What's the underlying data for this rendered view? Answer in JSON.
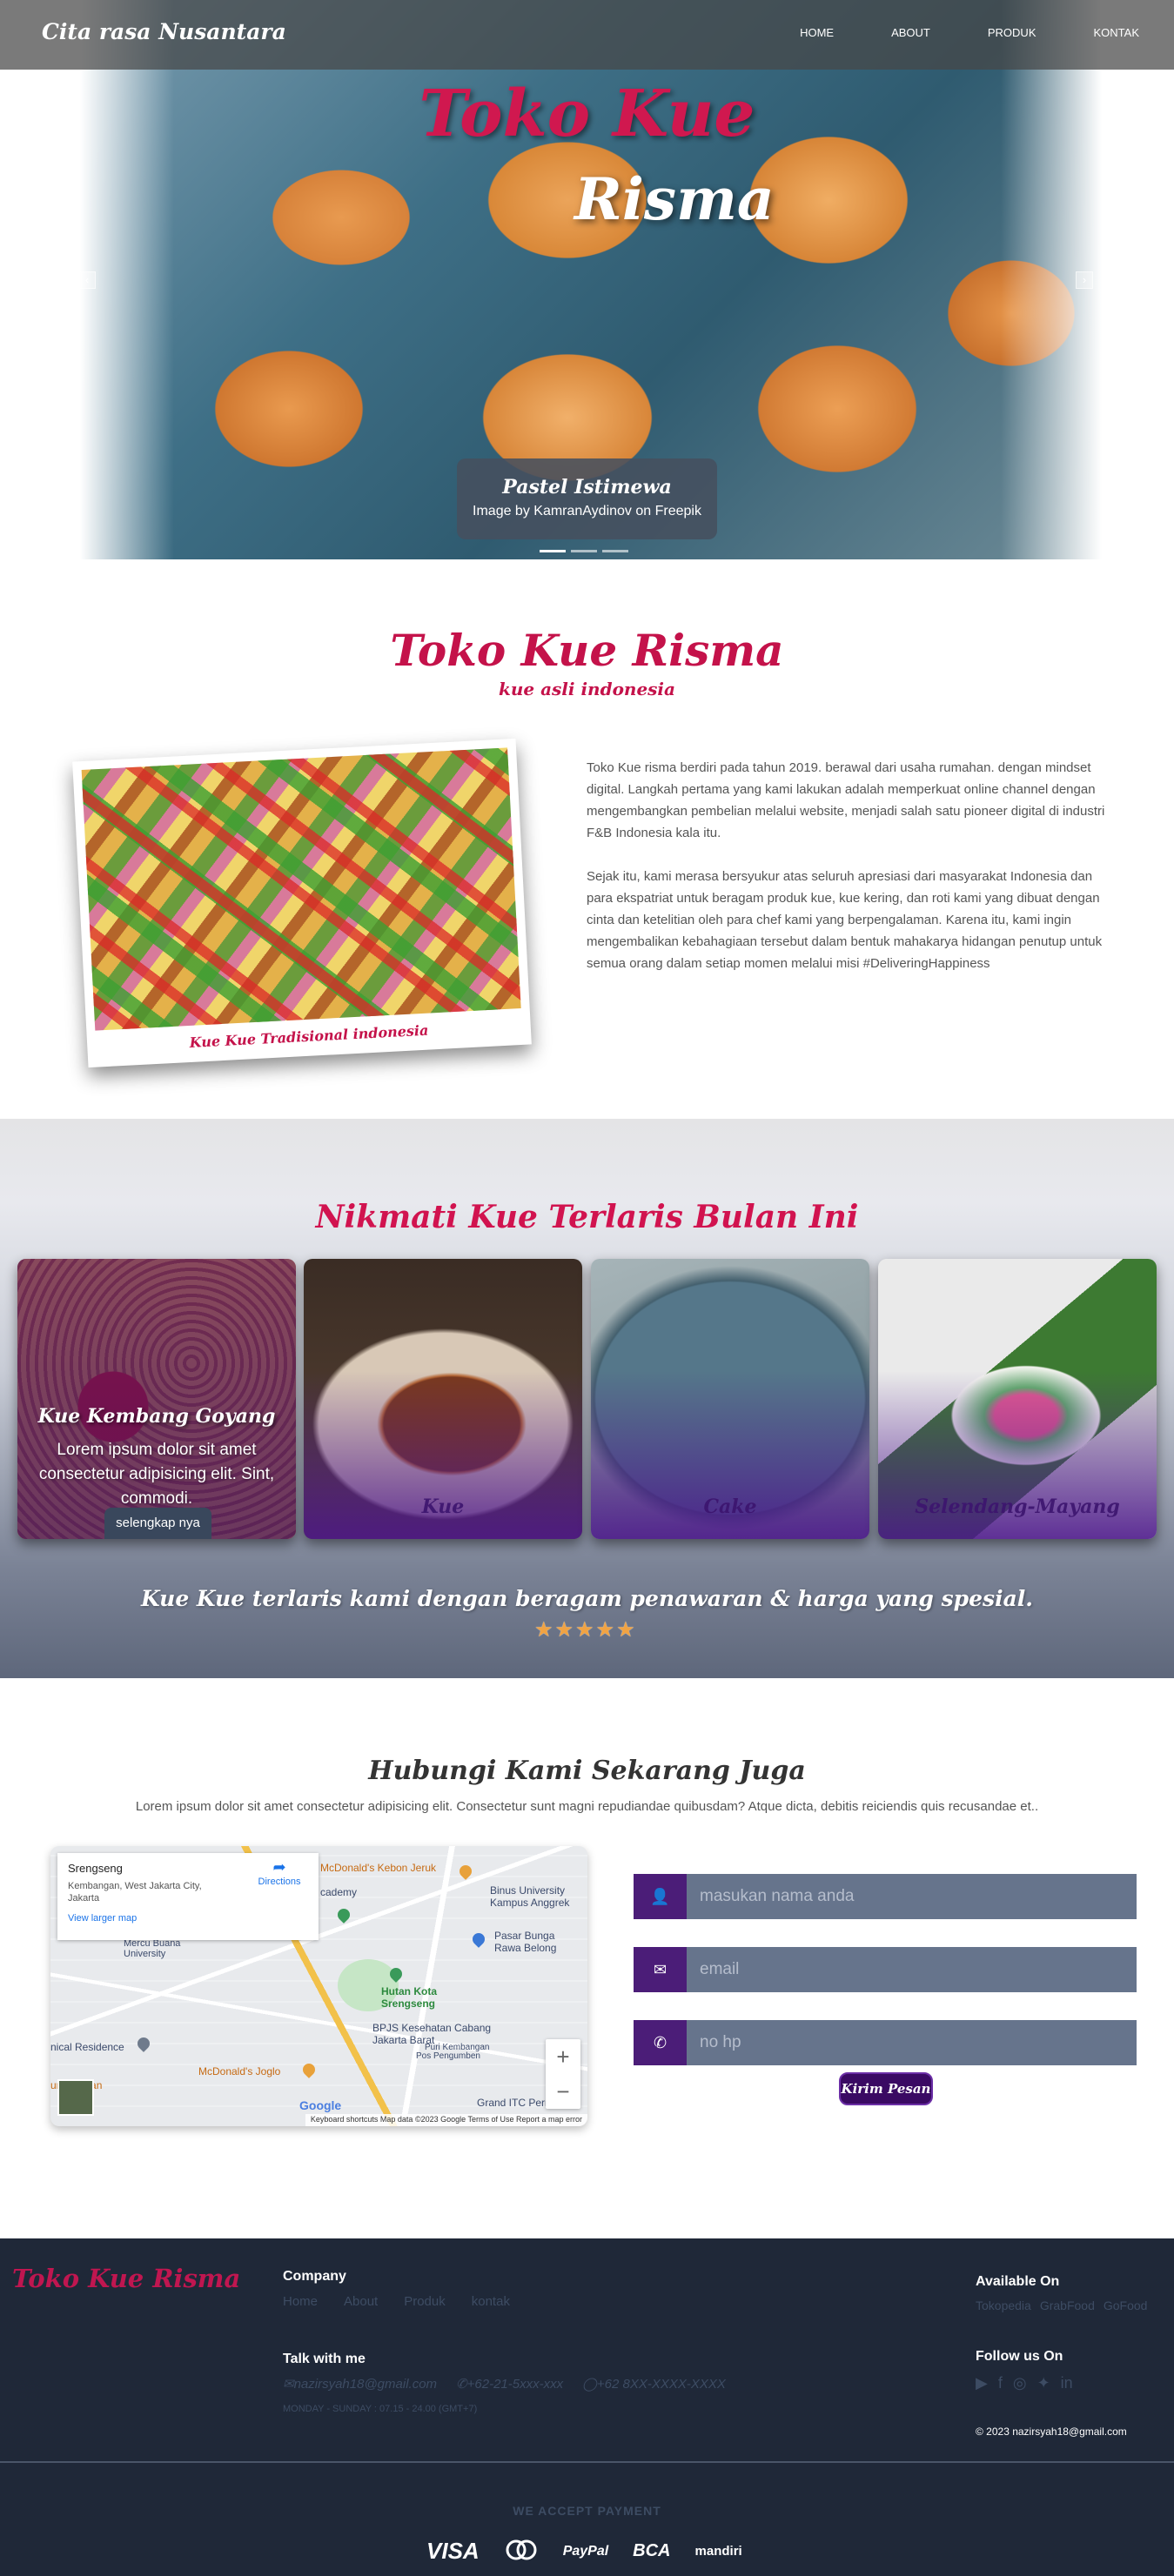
{
  "nav": {
    "brand": "Cita rasa Nusantara",
    "items": [
      "HOME",
      "ABOUT",
      "PRODUK",
      "KONTAK"
    ]
  },
  "hero": {
    "title_line1": "Toko Kue",
    "title_line2": "Risma",
    "prev_icon": "chevron-left-icon",
    "next_icon": "chevron-right-icon",
    "caption_title": "Pastel Istimewa",
    "caption_credit": "Image by KamranAydinov on Freepik"
  },
  "about": {
    "title": "Toko Kue Risma",
    "subtitle": "kue asli indonesia",
    "photo_caption": "Kue Kue Tradisional indonesia",
    "paragraphs": [
      "Toko Kue risma berdiri pada tahun 2019. berawal dari usaha rumahan. dengan mindset digital. Langkah pertama yang kami lakukan adalah memperkuat online channel dengan mengembangkan pembelian melalui website, menjadi salah satu pioneer digital di industri F&B Indonesia kala itu.",
      "Sejak itu, kami merasa bersyukur atas seluruh apresiasi dari masyarakat Indonesia dan para ekspatriat untuk beragam produk kue, kue kering, dan roti kami yang dibuat dengan cinta dan ketelitian oleh para chef kami yang berpengalaman. Karena itu, kami ingin mengembalikan kebahagiaan tersebut dalam bentuk mahakarya hidangan penutup untuk semua orang dalam setiap momen melalui misi #DeliveringHappiness"
    ]
  },
  "best": {
    "title": "Nikmati Kue Terlaris Bulan Ini",
    "cards": [
      {
        "name": "Kue Kembang Goyang",
        "desc": "Lorem ipsum dolor sit amet consectetur adipisicing elit. Sint, commodi.",
        "button": "selengkap nya"
      },
      {
        "name": "Kue"
      },
      {
        "name": "Cake"
      },
      {
        "name": "Selendang-Mayang"
      }
    ],
    "footer_text": "Kue Kue terlaris kami dengan beragam penawaran & harga yang spesial.",
    "rating": 5
  },
  "contact": {
    "title": "Hubungi Kami Sekarang Juga",
    "lead": "Lorem ipsum dolor sit amet consectetur adipisicing elit. Consectetur sunt magni repudiandae quibusdam? Atque dicta, debitis reiciendis quis recusandae et..",
    "map": {
      "place": "Srengseng",
      "address": "Kembangan, West Jakarta City, Jakarta",
      "larger_link": "View larger map",
      "directions": "Directions",
      "labels": [
        "McDonald's Kebon Jeruk",
        "Binus University Kampus Anggrek",
        "Pasar Bunga Rawa Belong",
        "Hutan Kota Srengseng",
        "BPJS Kesehatan Cabang Jakarta Barat",
        "Grand ITC Perm...",
        "McDonald's Joglo",
        "nical Residence",
        "ung Makan",
        "Mercu Buana University",
        "cademy",
        "Puri Kembangan",
        "Pos Pengumben"
      ],
      "zoom_in": "+",
      "zoom_out": "−",
      "google": "Google",
      "attribution": "Keyboard shortcuts    Map data ©2023 Google    Terms of Use    Report a map error"
    },
    "form": {
      "name_placeholder": "masukan nama anda",
      "email_placeholder": "email",
      "phone_placeholder": "no hp",
      "submit": "Kirim Pesan"
    }
  },
  "footer": {
    "logo": "Toko Kue Risma",
    "company_heading": "Company",
    "company_links": [
      "Home",
      "About",
      "Produk",
      "kontak"
    ],
    "talk_heading": "Talk with me",
    "email": "nazirsyah18@gmail.com",
    "phone": "+62-21-5xxx-xxx",
    "whatsapp": "+62 8XX-XXXX-XXXX",
    "hours": "MONDAY - SUNDAY : 07.15 - 24.00 (GMT+7)",
    "available_heading": "Available On",
    "available": [
      "Tokopedia",
      "GrabFood",
      "GoFood"
    ],
    "follow_heading": "Follow us On",
    "copyright": "© 2023 nazirsyah18@gmail.com",
    "payment_heading": "WE ACCEPT PAYMENT",
    "payments": [
      "VISA",
      "mastercard",
      "PayPal",
      "BCA",
      "mandiri"
    ]
  }
}
